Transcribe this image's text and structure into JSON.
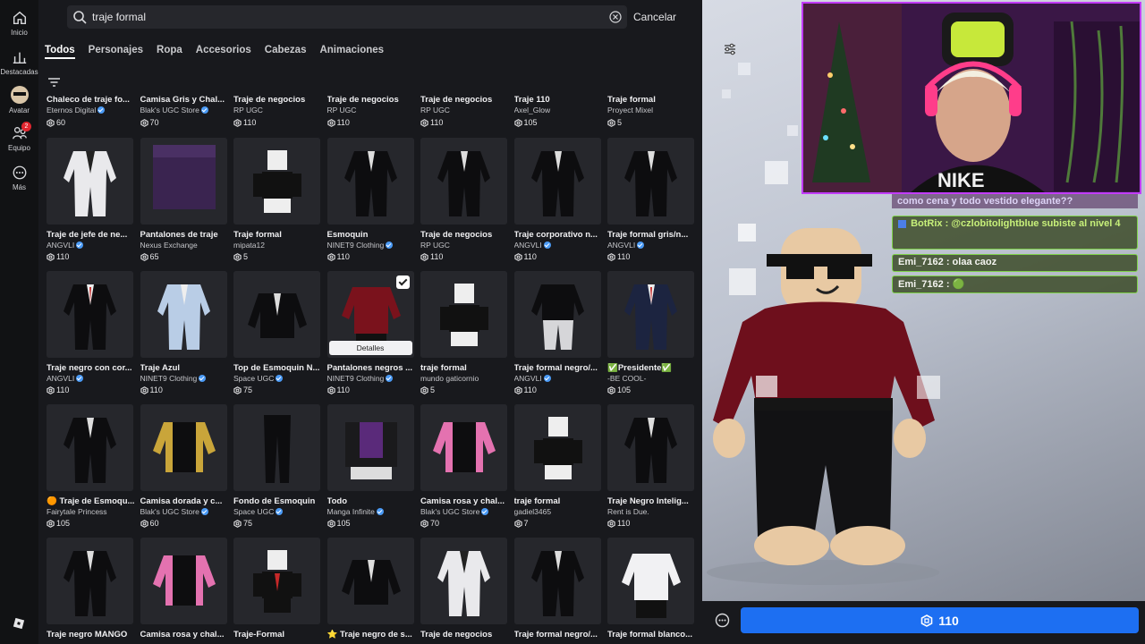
{
  "nav": {
    "items": [
      {
        "label": "Inicio",
        "icon": "home-icon"
      },
      {
        "label": "Destacadas",
        "icon": "chart-icon"
      },
      {
        "label": "Avatar",
        "icon": "avatar-icon"
      },
      {
        "label": "Equipo",
        "icon": "team-icon",
        "badge": "2"
      },
      {
        "label": "Más",
        "icon": "more-icon"
      }
    ]
  },
  "search": {
    "value": "traje formal",
    "cancel_label": "Cancelar"
  },
  "tabs": [
    "Todos",
    "Personajes",
    "Ropa",
    "Accesorios",
    "Cabezas",
    "Animaciones"
  ],
  "active_tab": "Todos",
  "top_row": [
    {
      "name": "Chaleco de traje fo...",
      "creator": "Eternos Digital",
      "verified": true,
      "price": "60"
    },
    {
      "name": "Camisa Gris y Chal...",
      "creator": "Blak's UGC Store",
      "verified": true,
      "price": "70"
    },
    {
      "name": "Traje de negocios",
      "creator": "RP UGC",
      "verified": false,
      "price": "110"
    },
    {
      "name": "Traje de negocios",
      "creator": "RP UGC",
      "verified": false,
      "price": "110"
    },
    {
      "name": "Traje de negocios",
      "creator": "RP UGC",
      "verified": false,
      "price": "110"
    },
    {
      "name": "Traje 110",
      "creator": "Axel_Glow",
      "verified": false,
      "price": "105"
    },
    {
      "name": "Traje formal",
      "creator": "Proyect Mixel",
      "verified": false,
      "price": "5"
    }
  ],
  "rows": [
    [
      {
        "name": "Traje de jefe de ne...",
        "creator": "ANGVLI",
        "verified": true,
        "price": "110",
        "art": "suit-white"
      },
      {
        "name": "Pantalones de traje",
        "creator": "Nexus Exchange",
        "verified": false,
        "price": "65",
        "art": "purple-box"
      },
      {
        "name": "Traje formal",
        "creator": "mipata12",
        "verified": false,
        "price": "5",
        "art": "blocky-formal"
      },
      {
        "name": "Esmoquin",
        "creator": "NINET9 Clothing",
        "verified": true,
        "price": "110",
        "art": "suit-black"
      },
      {
        "name": "Traje de negocios",
        "creator": "RP UGC",
        "verified": false,
        "price": "110",
        "art": "suit-black"
      },
      {
        "name": "Traje corporativo n...",
        "creator": "ANGVLI",
        "verified": true,
        "price": "110",
        "art": "suit-black"
      },
      {
        "name": "Traje formal gris/n...",
        "creator": "ANGVLI",
        "verified": true,
        "price": "110",
        "art": "suit-black"
      }
    ],
    [
      {
        "name": "Traje negro con cor...",
        "creator": "ANGVLI",
        "verified": true,
        "price": "110",
        "art": "suit-black-red"
      },
      {
        "name": "Traje Azul",
        "creator": "NINET9 Clothing",
        "verified": true,
        "price": "110",
        "art": "suit-blue"
      },
      {
        "name": "Top de Esmoquin N...",
        "creator": "Space UGC",
        "verified": true,
        "price": "75",
        "art": "jacket-black"
      },
      {
        "name": "Pantalones negros ...",
        "creator": "NINET9 Clothing",
        "verified": true,
        "price": "110",
        "art": "shirt-red",
        "selected": true
      },
      {
        "name": "traje formal",
        "creator": "mundo gaticornio",
        "verified": false,
        "price": "5",
        "art": "blocky-formal"
      },
      {
        "name": "Traje formal negro/...",
        "creator": "ANGVLI",
        "verified": true,
        "price": "110",
        "art": "suit-grey-pants"
      },
      {
        "name": "✅Presidente✅",
        "creator": "-BE COOL-",
        "verified": false,
        "price": "105",
        "art": "suit-navy"
      }
    ],
    [
      {
        "name": "🟠 Traje de Esmoqu...",
        "creator": "Fairytale Princess",
        "verified": false,
        "price": "105",
        "art": "suit-black"
      },
      {
        "name": "Camisa dorada y c...",
        "creator": "Blak's UGC Store",
        "verified": true,
        "price": "60",
        "art": "vest-gold"
      },
      {
        "name": "Fondo de Esmoquin",
        "creator": "Space UGC",
        "verified": true,
        "price": "75",
        "art": "pants-black"
      },
      {
        "name": "Todo",
        "creator": "Manga Infinite",
        "verified": true,
        "price": "105",
        "art": "blocky-purple"
      },
      {
        "name": "Camisa rosa y chal...",
        "creator": "Blak's UGC Store",
        "verified": true,
        "price": "70",
        "art": "vest-pink"
      },
      {
        "name": "traje formal",
        "creator": "gadiel3465",
        "verified": false,
        "price": "7",
        "art": "blocky-formal"
      },
      {
        "name": "Traje Negro Intelig...",
        "creator": "Rent is Due.",
        "verified": false,
        "price": "110",
        "art": "suit-black"
      }
    ],
    [
      {
        "name": "Traje negro MANGO",
        "creator": "",
        "verified": false,
        "price": "",
        "art": "suit-black"
      },
      {
        "name": "Camisa rosa y chal...",
        "creator": "",
        "verified": false,
        "price": "",
        "art": "vest-pink"
      },
      {
        "name": "Traje-Formal",
        "creator": "",
        "verified": false,
        "price": "",
        "art": "blocky-red"
      },
      {
        "name": "⭐ Traje negro de s...",
        "creator": "",
        "verified": false,
        "price": "",
        "art": "jacket-black"
      },
      {
        "name": "Traje de negocios",
        "creator": "",
        "verified": false,
        "price": "",
        "art": "suit-white"
      },
      {
        "name": "Traje formal negro/...",
        "creator": "",
        "verified": false,
        "price": "",
        "art": "suit-black"
      },
      {
        "name": "Traje formal blanco...",
        "creator": "",
        "verified": false,
        "price": "",
        "art": "shirt-white"
      }
    ]
  ],
  "details_label": "Detalles",
  "buy": {
    "price": "110"
  },
  "chat": {
    "top_line": "como cena y todo vestido elegante??",
    "messages": [
      {
        "user": "BotRix",
        "text": "@czlobitolightblue subiste al nivel 4",
        "system": true
      },
      {
        "user": "Emi_7162",
        "text": "olaa caoz",
        "system": false
      },
      {
        "user": "Emi_7162",
        "text": "🟢",
        "system": false
      }
    ]
  },
  "colors": {
    "accent": "#1d6ff2",
    "chat_border": "#7fd24a",
    "webcam_border": "#c23cff"
  }
}
